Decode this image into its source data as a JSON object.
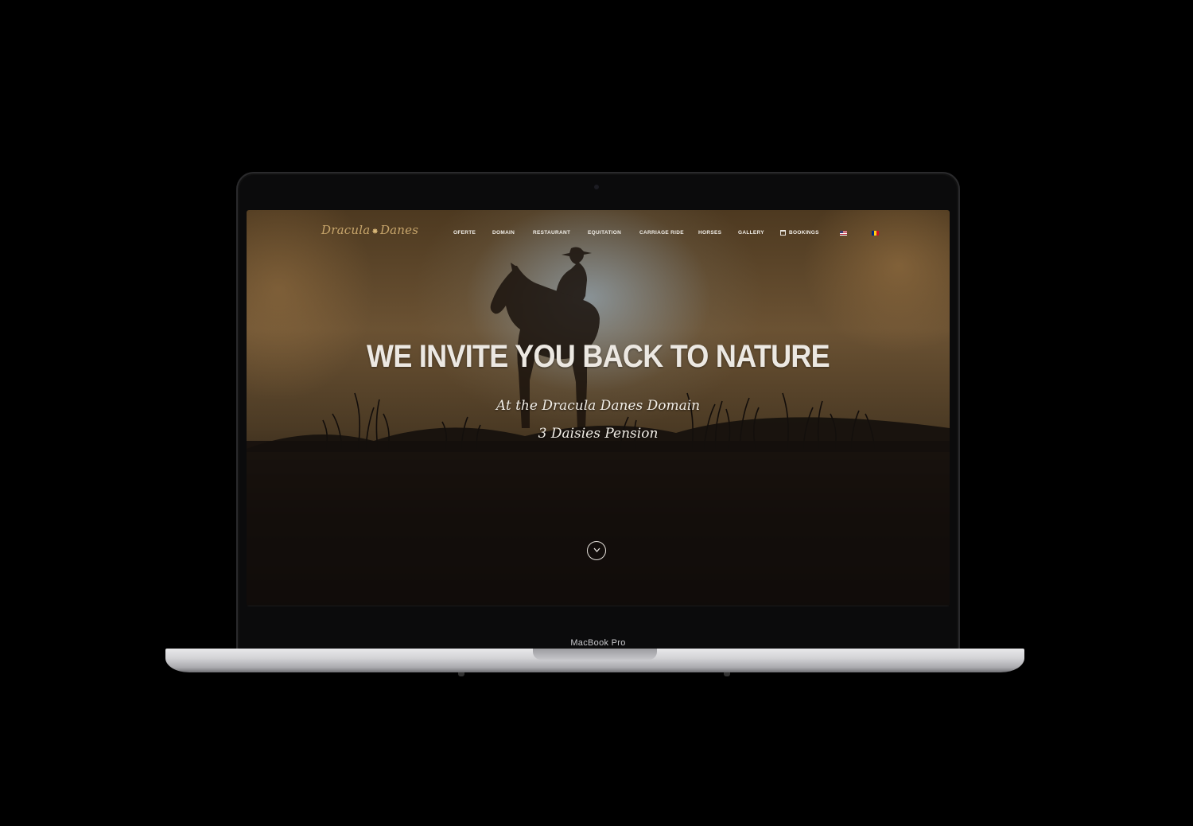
{
  "site": {
    "logo_text_1": "Dracula",
    "logo_text_2": "Danes",
    "nav": [
      {
        "label": "OFERTE"
      },
      {
        "label": "DOMAIN"
      },
      {
        "label": "RESTAURANT"
      },
      {
        "label": "EQUITATION"
      },
      {
        "label": "CARRIAGE RIDE"
      },
      {
        "label": "HORSES"
      },
      {
        "label": "GALLERY"
      },
      {
        "label": "BOOKINGS",
        "icon": "calendar-icon"
      }
    ],
    "languages": [
      {
        "name": "us-flag-icon"
      },
      {
        "name": "ro-flag-icon"
      }
    ]
  },
  "hero": {
    "title": "WE INVITE YOU BACK TO NATURE",
    "subtitle_1": "At the Dracula Danes Domain",
    "subtitle_2": "3 Daisies Pension",
    "scroll_icon": "chevron-down-icon"
  },
  "device": {
    "label": "MacBook Pro"
  },
  "colors": {
    "logo": "#c7a56b",
    "text": "#ece8e2",
    "background_top": "#6b5233",
    "background_bottom": "#0d0a0a"
  }
}
